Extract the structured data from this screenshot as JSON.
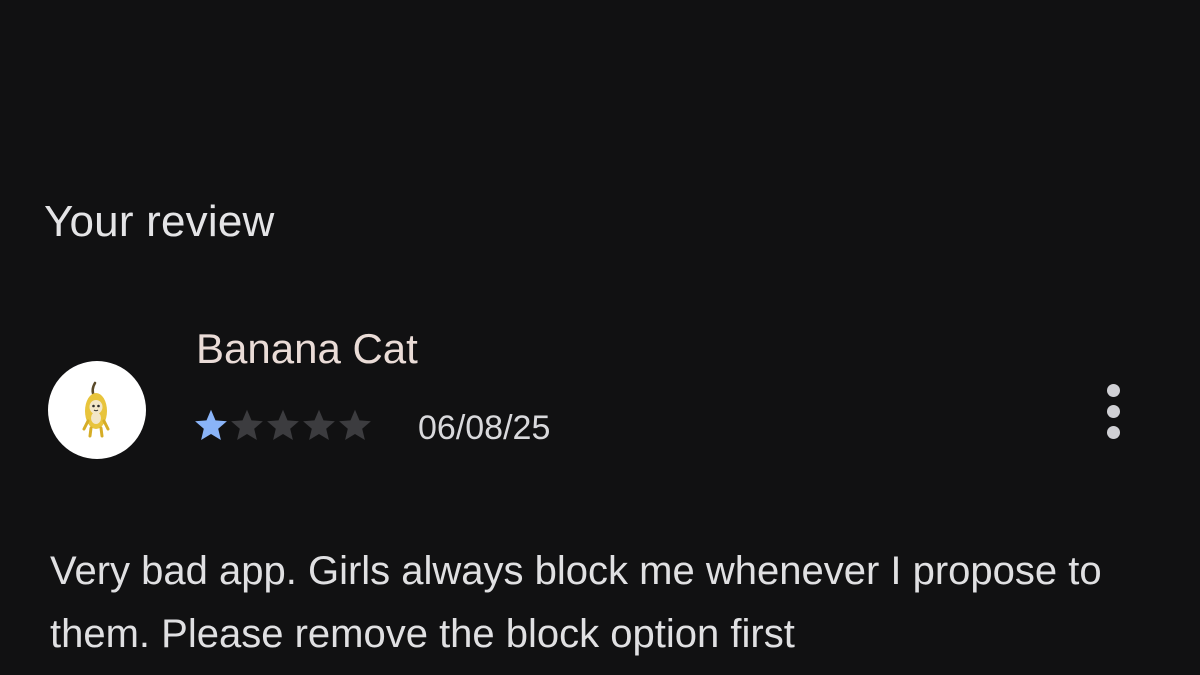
{
  "section": {
    "title": "Your review"
  },
  "review": {
    "reviewer_name": "Banana Cat",
    "avatar_icon": "banana-cat-avatar-icon",
    "rating": 1,
    "max_rating": 5,
    "date": "06/08/25",
    "text": "Very bad app. Girls always block me whenever I propose to them. Please remove the block option first"
  },
  "colors": {
    "background": "#111112",
    "star_filled": "#8ab4f8",
    "star_empty": "#3c3c3f"
  },
  "menu": {
    "icon": "more-vertical-icon"
  }
}
